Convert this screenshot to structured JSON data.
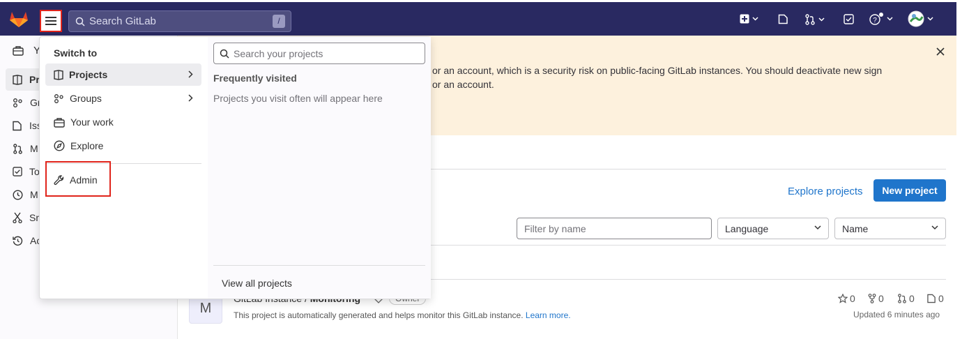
{
  "topbar": {
    "search_placeholder": "Search GitLab",
    "search_shortcut": "/"
  },
  "sidebar": {
    "items": [
      {
        "label": "Y",
        "icon": "briefcase-icon"
      },
      {
        "label": "Pr",
        "icon": "project-icon"
      },
      {
        "label": "Gr",
        "icon": "group-icon"
      },
      {
        "label": "Iss",
        "icon": "issues-icon"
      },
      {
        "label": "M",
        "icon": "merge-request-icon"
      },
      {
        "label": "To",
        "icon": "todo-icon"
      },
      {
        "label": "M",
        "icon": "clock-icon"
      },
      {
        "label": "Sn",
        "icon": "snippet-icon"
      },
      {
        "label": "Ac",
        "icon": "history-icon"
      }
    ]
  },
  "banner": {
    "line1": "or an account, which is a security risk on public-facing GitLab instances. You should deactivate new sign",
    "line2": "or an account."
  },
  "main": {
    "explore_projects": "Explore projects",
    "new_project": "New project",
    "filter_placeholder": "Filter by name",
    "language_select": "Language",
    "sort_select": "Name",
    "project": {
      "avatar_letter": "M",
      "title_prefix": "GitLab Instance / ",
      "title_name": "Monitoring",
      "role": "Owner",
      "description": "This project is automatically generated and helps monitor this GitLab instance.",
      "learn_more": "Learn more.",
      "stars": "0",
      "forks": "0",
      "merge_requests": "0",
      "issues": "0",
      "updated": "Updated 6 minutes ago"
    }
  },
  "menu": {
    "heading": "Switch to",
    "items": [
      {
        "label": "Projects",
        "icon": "project-icon"
      },
      {
        "label": "Groups",
        "icon": "group-icon"
      },
      {
        "label": "Your work",
        "icon": "briefcase-icon"
      },
      {
        "label": "Explore",
        "icon": "compass-icon"
      },
      {
        "label": "Admin",
        "icon": "wrench-icon"
      }
    ],
    "projects_search_placeholder": "Search your projects",
    "frequently_visited": "Frequently visited",
    "empty_text": "Projects you visit often will appear here",
    "view_all": "View all projects"
  },
  "colors": {
    "topbar": "#292961",
    "banner": "#fdf1dd",
    "primary": "#1f75cb",
    "highlight_box": "#e0241b"
  }
}
